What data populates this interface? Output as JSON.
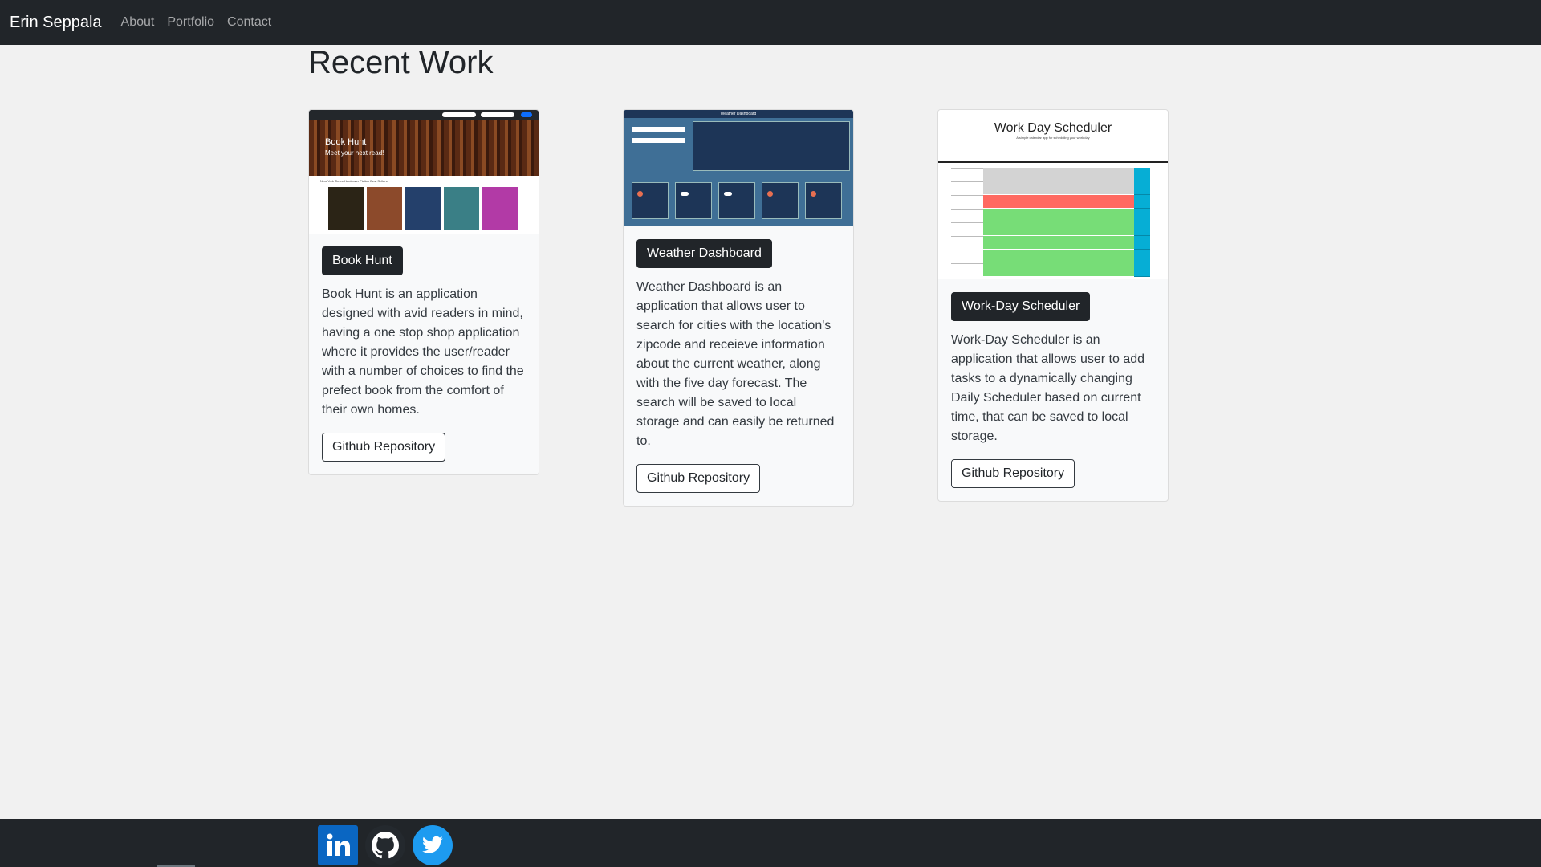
{
  "navbar": {
    "brand": "Erin Seppala",
    "links": [
      "About",
      "Portfolio",
      "Contact"
    ]
  },
  "main": {
    "title": "Recent Work"
  },
  "cards": [
    {
      "title": "Book Hunt",
      "description": "Book Hunt is an application designed with avid readers in mind, having a one stop shop application where it provides the user/reader with a number of choices to find the prefect book from the comfort of their own homes.",
      "repo_label": "Github Repository",
      "thumb": {
        "hero_title": "Book Hunt",
        "hero_sub": "Meet your next read!",
        "caption": "New York Times Hardcover Fiction Best Sellers"
      }
    },
    {
      "title": "Weather Dashboard",
      "description": "Weather Dashboard is an application that allows user to search for cities with the location's zipcode and receieve information about the current weather, along with the five day forecast. The search will be saved to local storage and can easily be returned to.",
      "repo_label": "Github Repository",
      "thumb": {
        "header": "Weather Dashboard"
      }
    },
    {
      "title": "Work-Day Scheduler",
      "description": "Work-Day Scheduler is an application that allows user to add tasks to a dynamically changing Daily Scheduler based on current time, that can be saved to local storage.",
      "repo_label": "Github Repository",
      "thumb": {
        "title": "Work Day Scheduler",
        "subtitle": "A simple calendar app for scheduling your work day"
      }
    }
  ],
  "footer": {
    "social": [
      "linkedin-icon",
      "github-icon",
      "twitter-icon"
    ],
    "colors": {
      "linkedin": "#0a66c2",
      "github": "#24292e",
      "twitter": "#1d9bf0"
    }
  }
}
